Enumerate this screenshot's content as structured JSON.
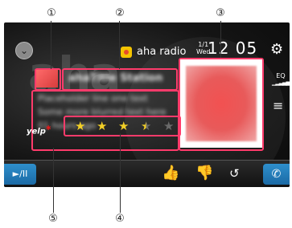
{
  "callouts": [
    "①",
    "②",
    "③",
    "④",
    "⑤"
  ],
  "header": {
    "back_icon": "chevron-down-icon",
    "brand_name": "aha radio",
    "date_top": "1/1",
    "date_bottom": "Wed",
    "clock": "12 05",
    "settings_icon": "gear-icon"
  },
  "station": {
    "title": "ahaTitle Station"
  },
  "info_lines": [
    "Placeholder line one text",
    "Some more blurred text here",
    "01 hours ago"
  ],
  "side": {
    "eq_label": "EQ",
    "eq_bars": "▁▂▃▄▅",
    "list_icon": "≡"
  },
  "yelp": {
    "label": "yelp"
  },
  "rating": {
    "value": 3.5,
    "max": 5
  },
  "bottom_bar": {
    "play_pause_label": "►/II",
    "like_icon": "thumbs-up-icon",
    "dislike_icon": "thumbs-down-icon",
    "replay_icon": "replay-icon",
    "phone_icon": "phone-icon"
  }
}
